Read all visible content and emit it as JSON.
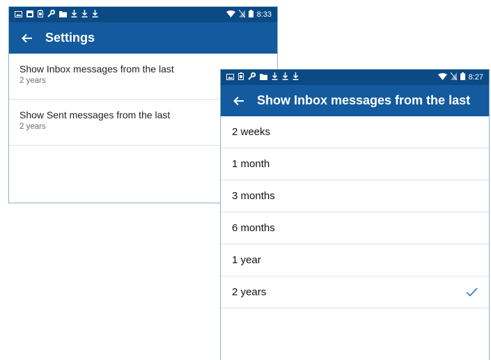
{
  "back_screen": {
    "status_bar": {
      "time": "8:33",
      "left_icons": [
        "picture-icon",
        "sim-icon",
        "battery-saver-icon",
        "wrench-icon",
        "folder-icon",
        "download-icon",
        "download-icon",
        "download-icon"
      ],
      "right_icons": [
        "wifi-icon",
        "no-sim-icon",
        "battery-icon"
      ]
    },
    "toolbar": {
      "title": "Settings"
    },
    "preferences": [
      {
        "title": "Show Inbox messages from the last",
        "summary": "2 years"
      },
      {
        "title": "Show Sent messages from the last",
        "summary": "2 years"
      }
    ]
  },
  "front_screen": {
    "status_bar": {
      "time": "8:27",
      "left_icons": [
        "picture-icon",
        "battery-saver-icon",
        "wrench-icon",
        "folder-icon",
        "download-icon",
        "download-icon",
        "download-icon"
      ],
      "right_icons": [
        "wifi-icon",
        "no-sim-icon",
        "battery-icon"
      ]
    },
    "toolbar": {
      "title": "Show Inbox messages from the last"
    },
    "options": [
      {
        "label": "2 weeks",
        "selected": false
      },
      {
        "label": "1 month",
        "selected": false
      },
      {
        "label": "3 months",
        "selected": false
      },
      {
        "label": "6 months",
        "selected": false
      },
      {
        "label": "1 year",
        "selected": false
      },
      {
        "label": "2 years",
        "selected": true
      }
    ]
  },
  "colors": {
    "status_bar": "#0b4a84",
    "toolbar": "#135a9e",
    "check": "#2f7fd0"
  }
}
